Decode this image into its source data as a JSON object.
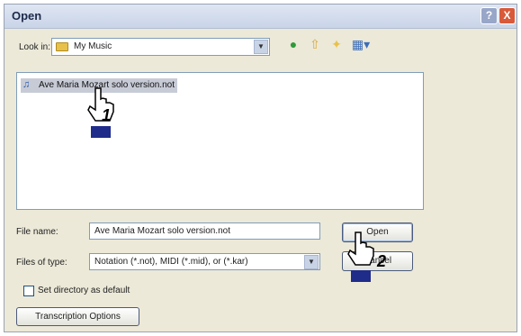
{
  "window": {
    "title": "Open",
    "help_glyph": "?",
    "close_glyph": "X"
  },
  "lookin": {
    "label": "Look in:",
    "value": "My Music"
  },
  "toolbar": {
    "icons": [
      "back-icon",
      "up-folder-icon",
      "new-folder-icon",
      "view-menu-icon"
    ]
  },
  "files": [
    {
      "name": "Ave Maria Mozart solo version.not",
      "selected": true
    }
  ],
  "filename": {
    "label": "File name:",
    "value": "Ave Maria Mozart solo version.not"
  },
  "filetype": {
    "label": "Files of type:",
    "value": "Notation (*.not), MIDI (*.mid), or (*.kar)"
  },
  "buttons": {
    "open": "Open",
    "cancel": "Cancel",
    "transcription": "Transcription Options"
  },
  "checkbox": {
    "label": "Set directory as default",
    "checked": false
  },
  "callouts": {
    "step1": "1",
    "step2": "2"
  }
}
